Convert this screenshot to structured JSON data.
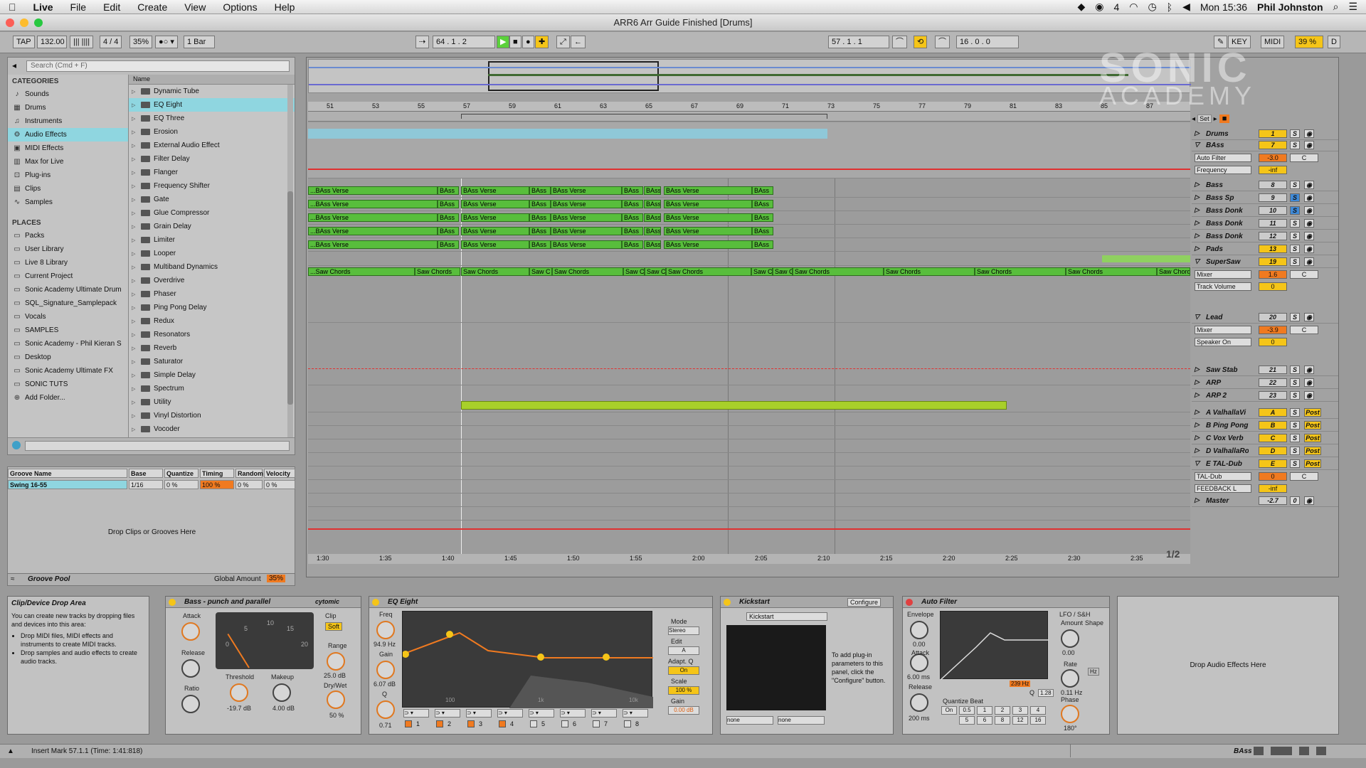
{
  "menubar": {
    "apple": "",
    "app": "Live",
    "items": [
      "File",
      "Edit",
      "Create",
      "View",
      "Options",
      "Help"
    ],
    "clock": "Mon 15:36",
    "user": "Phil Johnston",
    "badge": "4"
  },
  "window": {
    "title": "ARR6 Arr Guide Finished  [Drums]"
  },
  "control": {
    "tap": "TAP",
    "tempo": "132.00",
    "sig_num": "4",
    "sig_den": "4",
    "swing": "35%",
    "quant": "1 Bar",
    "pos_arr": "64 .   1 .   2",
    "pos_loop": "57 .   1 .   1",
    "loop_len": "16 .   0 .   0",
    "key": "KEY",
    "midi": "MIDI",
    "cpu": "39 %",
    "d": "D"
  },
  "watermark": {
    "line1": "SONIC",
    "line2": "ACADEMY"
  },
  "browser": {
    "search_placeholder": "Search (Cmd + F)",
    "categories_title": "CATEGORIES",
    "categories": [
      {
        "label": "Sounds",
        "icon": "♪"
      },
      {
        "label": "Drums",
        "icon": "▦"
      },
      {
        "label": "Instruments",
        "icon": "♫"
      },
      {
        "label": "Audio Effects",
        "icon": "⚙"
      },
      {
        "label": "MIDI Effects",
        "icon": "▣"
      },
      {
        "label": "Max for Live",
        "icon": "▥"
      },
      {
        "label": "Plug-ins",
        "icon": "⊡"
      },
      {
        "label": "Clips",
        "icon": "▤"
      },
      {
        "label": "Samples",
        "icon": "∿"
      }
    ],
    "places_title": "PLACES",
    "places": [
      "Packs",
      "User Library",
      "Live 8 Library",
      "Current Project",
      "Sonic Academy Ultimate Drum",
      "SQL_Signature_Samplepack",
      "Vocals",
      "SAMPLES",
      "Sonic Academy - Phil Kieran S",
      "Desktop",
      "Sonic Academy Ultimate FX",
      "SONIC TUTS",
      "Add Folder..."
    ],
    "name_header": "Name",
    "items": [
      "Dynamic Tube",
      "EQ Eight",
      "EQ Three",
      "Erosion",
      "External Audio Effect",
      "Filter Delay",
      "Flanger",
      "Frequency Shifter",
      "Gate",
      "Glue Compressor",
      "Grain Delay",
      "Limiter",
      "Looper",
      "Multiband Dynamics",
      "Overdrive",
      "Phaser",
      "Ping Pong Delay",
      "Redux",
      "Resonators",
      "Reverb",
      "Saturator",
      "Simple Delay",
      "Spectrum",
      "Utility",
      "Vinyl Distortion",
      "Vocoder"
    ]
  },
  "groove": {
    "headers": [
      "Groove Name",
      "Base",
      "Quantize",
      "Timing",
      "Random",
      "Velocity"
    ],
    "row": {
      "name": "Swing 16-55",
      "base": "1/16",
      "quantize": "0 %",
      "timing": "100 %",
      "random": "0 %",
      "velocity": "0 %"
    },
    "drop_hint": "Drop Clips or Grooves Here",
    "footer": "Groove Pool",
    "global_label": "Global Amount",
    "global_value": "35%"
  },
  "ruler": {
    "bars": [
      "51",
      "53",
      "55",
      "57",
      "59",
      "61",
      "63",
      "65",
      "67",
      "69",
      "71",
      "73",
      "75",
      "77",
      "79",
      "81",
      "83",
      "85",
      "87"
    ],
    "times": [
      "1:30",
      "1:35",
      "1:40",
      "1:45",
      "1:50",
      "1:55",
      "2:00",
      "2:05",
      "2:10",
      "2:15",
      "2:20",
      "2:25",
      "2:30",
      "2:35"
    ],
    "page": "1/2",
    "set": "Set"
  },
  "clips": {
    "bass": "BAss Verse",
    "bass_short": "BAss",
    "bass_first": "...BAss Verse",
    "saw": "Saw Chords",
    "saw_first": "...Saw Chords",
    "saw_short": "Saw C"
  },
  "tracks": [
    {
      "name": "Drums",
      "num": "1",
      "s": "S"
    },
    {
      "name": "BAss",
      "num": "7",
      "s": "S",
      "sub": [
        {
          "label": "Auto Filter",
          "val": "-3.0",
          "c": "C"
        },
        {
          "label": "Frequency",
          "val": "-inf"
        }
      ]
    },
    {
      "name": "Bass",
      "num": "8",
      "s": "S"
    },
    {
      "name": "Bass Sp",
      "num": "9",
      "s": "S"
    },
    {
      "name": "Bass Donk",
      "num": "10",
      "s": "S"
    },
    {
      "name": "Bass Donk",
      "num": "11",
      "s": "S"
    },
    {
      "name": "Bass Donk",
      "num": "12",
      "s": "S"
    },
    {
      "name": "Pads",
      "num": "13",
      "s": "S"
    },
    {
      "name": "SuperSaw",
      "num": "19",
      "s": "S",
      "sub": [
        {
          "label": "Mixer",
          "val": "1.6",
          "c": "C"
        },
        {
          "label": "Track Volume",
          "val": "0"
        }
      ]
    },
    {
      "name": "Lead",
      "num": "20",
      "s": "S",
      "sub": [
        {
          "label": "Mixer",
          "val": "-3.9",
          "c": "C"
        },
        {
          "label": "Speaker On",
          "val": "0"
        }
      ]
    },
    {
      "name": "Saw Stab",
      "num": "21",
      "s": "S"
    },
    {
      "name": "ARP",
      "num": "22",
      "s": "S"
    },
    {
      "name": "ARP 2",
      "num": "23",
      "s": "S"
    },
    {
      "name": "A ValhallaVi",
      "num": "A",
      "s": "S",
      "post": "Post"
    },
    {
      "name": "B Ping Pong",
      "num": "B",
      "s": "S",
      "post": "Post"
    },
    {
      "name": "C Vox Verb",
      "num": "C",
      "s": "S",
      "post": "Post"
    },
    {
      "name": "D ValhallaRo",
      "num": "D",
      "s": "S",
      "post": "Post"
    },
    {
      "name": "E TAL-Dub",
      "num": "E",
      "s": "S",
      "post": "Post",
      "sub": [
        {
          "label": "TAL-Dub",
          "val": "0",
          "c": "C"
        },
        {
          "label": "FEEDBACK L",
          "val": "-inf"
        }
      ]
    },
    {
      "name": "Master",
      "num": "-2.7",
      "s": "0"
    }
  ],
  "devices": {
    "drop_area_title": "Clip/Device Drop Area",
    "drop_area_text": "You can create new tracks by dropping files and devices into this area:",
    "drop_bullets": [
      "Drop MIDI files, MIDI effects and instruments to create MIDI tracks.",
      "Drop samples and audio effects to create audio tracks."
    ],
    "comp": {
      "title": "Bass - punch and parallel",
      "brand": "cytomic",
      "attack": "Attack",
      "release": "Release",
      "ratio": "Ratio",
      "clip": "Clip",
      "soft": "Soft",
      "threshold": "Threshold",
      "threshold_val": "-19.7 dB",
      "makeup": "Makeup",
      "makeup_val": "4.00 dB",
      "range": "Range",
      "range_val": "25.0 dB",
      "drywet": "Dry/Wet",
      "drywet_val": "50 %",
      "meter": [
        "0",
        "5",
        "10",
        "15",
        "20"
      ]
    },
    "eq": {
      "title": "EQ Eight",
      "freq": "Freq",
      "freq_val": "94.9 Hz",
      "gain": "Gain",
      "gain_val": "6.07 dB",
      "q": "Q",
      "q_val": "0.71",
      "mode": "Mode",
      "mode_val": "Stereo",
      "edit": "Edit",
      "edit_val": "A",
      "adapt": "Adapt. Q",
      "adapt_val": "On",
      "scale": "Scale",
      "scale_val": "100 %",
      "gain2": "Gain",
      "gain2_val": "0.00 dB",
      "bands": [
        "1",
        "2",
        "3",
        "4",
        "5",
        "6",
        "7",
        "8"
      ],
      "axis": [
        "100",
        "1k",
        "10k"
      ],
      "db": [
        "12",
        "6",
        "0",
        "-6",
        "-12"
      ]
    },
    "kick": {
      "title": "Kickstart",
      "configure": "Configure",
      "plugin": "Kickstart",
      "hint": "To add plug-in parameters to this panel, click the \"Configure\" button.",
      "none1": "none",
      "none2": "none"
    },
    "af": {
      "title": "Auto Filter",
      "envelope": "Envelope",
      "env_val": "0.00",
      "attack": "Attack",
      "attack_val": "6.00 ms",
      "release": "Release",
      "release_val": "200 ms",
      "freq": "239 Hz",
      "q": "Q",
      "q_val": "1.28",
      "qb": "Quantize Beat",
      "qb_vals": [
        "On",
        "0.5",
        "1",
        "2",
        "3",
        "4",
        "5",
        "6",
        "8",
        "12",
        "16"
      ],
      "lfo": "LFO / S&H",
      "amount": "Amount",
      "amount_val": "0.00",
      "shape": "Shape",
      "rate": "Rate",
      "rate_val": "0.11 Hz",
      "phase": "Phase",
      "phase_val": "180°",
      "hz": "Hz"
    },
    "drop_fx": "Drop Audio Effects Here"
  },
  "status": {
    "text": "Insert Mark 57.1.1 (Time: 1:41:818)",
    "track": "BAss"
  }
}
